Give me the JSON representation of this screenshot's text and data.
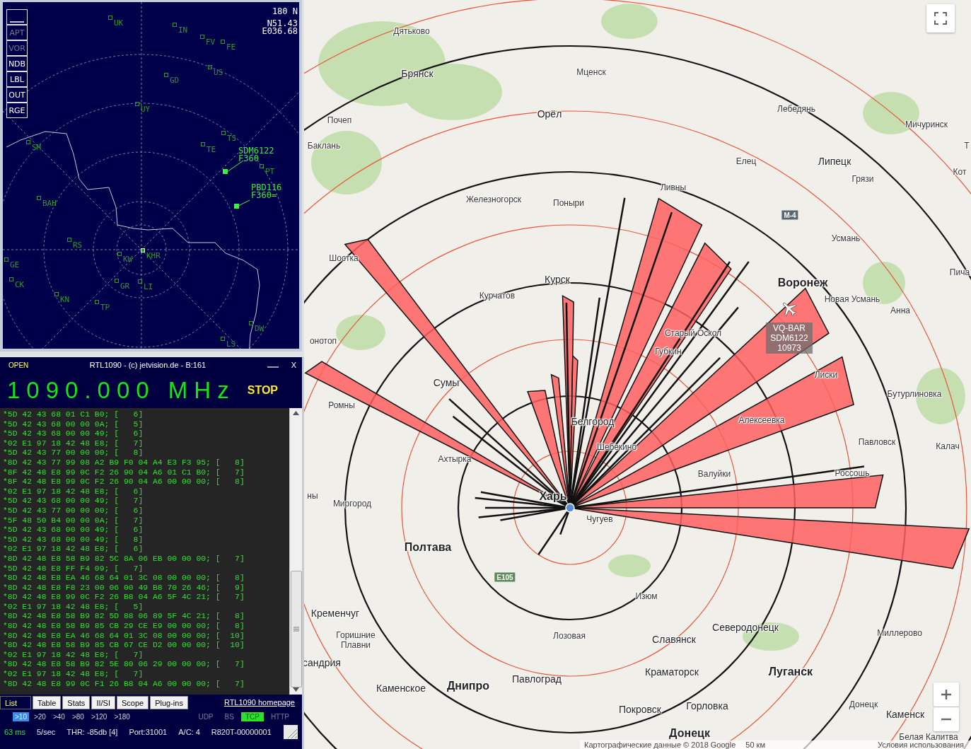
{
  "radar": {
    "buttons": [
      {
        "kind": "line",
        "on": true
      },
      {
        "kind": "text",
        "label": "APT",
        "on": false
      },
      {
        "kind": "text",
        "label": "VOR",
        "on": false
      },
      {
        "kind": "text",
        "label": "NDB",
        "on": true
      },
      {
        "kind": "text",
        "label": "LBL",
        "on": true
      },
      {
        "kind": "text",
        "label": "OUT",
        "on": true
      },
      {
        "kind": "text",
        "label": "RGE",
        "on": true
      }
    ],
    "range": "180 N",
    "position": [
      "N51.43",
      "E036.68"
    ],
    "fixes": [
      "UK",
      "IN",
      "FV",
      "FE",
      "US",
      "GD",
      "UY",
      "TS",
      "TE",
      "SM",
      "PT",
      "BAH",
      "RS",
      "GE",
      "KW",
      "KHR",
      "CK",
      "GR",
      "LI",
      "KN",
      "TP",
      "DW",
      "LS"
    ],
    "aircraft": [
      {
        "callsign": "SDM6122",
        "flight_level": "F360"
      },
      {
        "callsign": "PBD116",
        "flight_level": "F360="
      }
    ]
  },
  "receiver": {
    "open_label": "OPEN",
    "title": "RTL1090 - (c) jetvision.de - B:161",
    "close": "X",
    "frequency": "1090.000 MHz",
    "stop": "STOP",
    "messages": [
      "*5D 42 43 68 01 C1 B0; [   6]",
      "*5D 42 43 68 00 00 0A; [   5]",
      "*5D 42 43 68 00 00 49; [   6]",
      "*02 E1 97 18 42 48 E8; [   7]",
      "*5D 42 43 77 00 00 00; [   8]",
      "*8D 42 43 77 99 08 A2 B9 F0 04 A4 E3 F3 95; [   8]",
      "*8F 42 48 E8 99 0C F2 26 90 04 A6 01 C1 B0; [   7]",
      "*8F 42 48 E8 99 0C F2 26 90 04 A6 00 00 00; [   8]",
      "*02 E1 97 18 42 48 E8; [   6]",
      "*5D 42 43 68 00 00 49; [   7]",
      "*5D 42 43 77 00 00 00; [   6]",
      "*5F 48 50 B4 00 00 0A; [   7]",
      "*5D 42 43 68 00 00 49; [   6]",
      "*5D 42 43 68 00 00 49; [   8]",
      "*02 E1 97 18 42 48 E8; [   6]",
      "*8D 42 48 E8 58 B9 82 5C 8A 06 EB 00 00 00; [   7]",
      "*5D 42 48 E8 FF F4 09; [   7]",
      "*8D 42 48 E8 EA 46 68 64 01 3C 08 00 00 00; [   8]",
      "*8D 42 48 E8 F8 23 00 06 00 49 B8 70 26 46; [   9]",
      "*8D 42 48 E8 99 0C F2 26 B8 04 A6 5F 4C 21; [   7]",
      "*02 E1 97 18 42 48 E8; [   5]",
      "*8D 42 48 E8 58 B9 82 5D 88 06 89 5F 4C 21; [   8]",
      "*8D 42 48 E8 58 B9 85 CB 29 CE E9 00 00 00; [   8]",
      "*8D 42 48 E8 EA 46 68 64 01 3C 08 00 00 00; [  10]",
      "*8D 42 48 E8 58 B9 85 CB 67 CE D2 00 00 00; [  10]",
      "*02 E1 97 18 42 48 E8; [   7]",
      "*8D 42 48 E8 58 B9 82 5E 80 06 29 00 00 00; [   7]",
      "*02 E1 97 18 42 48 E8; [   7]",
      "*8D 42 48 E8 99 0C F1 26 B8 04 A6 00 00 00; [   7]"
    ],
    "tabs": [
      {
        "label": "List",
        "selected": true
      },
      {
        "label": "Table",
        "selected": false
      },
      {
        "label": "Stats",
        "selected": false
      },
      {
        "label": "II/SI",
        "selected": false
      },
      {
        "label": "Scope",
        "selected": false
      },
      {
        "label": "Plug-ins",
        "selected": false
      }
    ],
    "homepage_link": "RTL1090 homepage",
    "ranges": [
      {
        "label": ">10",
        "selected": true
      },
      {
        "label": ">20",
        "selected": false
      },
      {
        "label": ">40",
        "selected": false
      },
      {
        "label": ">80",
        "selected": false
      },
      {
        "label": ">120",
        "selected": false
      },
      {
        "label": ">180",
        "selected": false
      }
    ],
    "outputs": [
      {
        "label": "UDP",
        "on": false
      },
      {
        "label": "BS",
        "on": false
      },
      {
        "label": "TCP",
        "on": true
      },
      {
        "label": "HTTP",
        "on": false
      }
    ],
    "status": {
      "latency": "63 ms",
      "rate": "5/sec",
      "threshold": "THR: -85db [4]",
      "port": "Port:31001",
      "aircraft_count": "A/C: 4",
      "device": "R820T-00000001"
    }
  },
  "map": {
    "places": [
      {
        "name": "Дятьково",
        "kind": "town"
      },
      {
        "name": "Брянск",
        "kind": "city"
      },
      {
        "name": "Мценск",
        "kind": "town"
      },
      {
        "name": "Орёл",
        "kind": "city"
      },
      {
        "name": "Лебедянь",
        "kind": "town"
      },
      {
        "name": "Почеп",
        "kind": "town"
      },
      {
        "name": "Мичуринск",
        "kind": "town"
      },
      {
        "name": "Т",
        "kind": "town"
      },
      {
        "name": "Баклань",
        "kind": "town"
      },
      {
        "name": "Елец",
        "kind": "town"
      },
      {
        "name": "Липецк",
        "kind": "city"
      },
      {
        "name": "Кот",
        "kind": "town"
      },
      {
        "name": "Грязи",
        "kind": "town"
      },
      {
        "name": "Ливны",
        "kind": "town"
      },
      {
        "name": "Железногорск",
        "kind": "town"
      },
      {
        "name": "Поныри",
        "kind": "town"
      },
      {
        "name": "Усмань",
        "kind": "town"
      },
      {
        "name": "Шостка",
        "kind": "town"
      },
      {
        "name": "Пича",
        "kind": "town"
      },
      {
        "name": "Курск",
        "kind": "city"
      },
      {
        "name": "Воронеж",
        "kind": "major"
      },
      {
        "name": "Курчатов",
        "kind": "town"
      },
      {
        "name": "Новая Усмань",
        "kind": "town"
      },
      {
        "name": "Анна",
        "kind": "town"
      },
      {
        "name": "Старый Оскол",
        "kind": "town"
      },
      {
        "name": "онотоп",
        "kind": "town"
      },
      {
        "name": "Губкин",
        "kind": "town"
      },
      {
        "name": "Лиски",
        "kind": "town"
      },
      {
        "name": "Сумы",
        "kind": "city"
      },
      {
        "name": "Бутурлиновка",
        "kind": "town"
      },
      {
        "name": "Ромны",
        "kind": "town"
      },
      {
        "name": "Белгород",
        "kind": "city"
      },
      {
        "name": "Алексеевка",
        "kind": "town"
      },
      {
        "name": "Павловск",
        "kind": "town"
      },
      {
        "name": "Калач",
        "kind": "town"
      },
      {
        "name": "Шебекино",
        "kind": "town"
      },
      {
        "name": "Ахтырка",
        "kind": "town"
      },
      {
        "name": "Валуйки",
        "kind": "town"
      },
      {
        "name": "Россошь",
        "kind": "town"
      },
      {
        "name": "ны",
        "kind": "town"
      },
      {
        "name": "Харь",
        "kind": "major"
      },
      {
        "name": "Миргород",
        "kind": "town"
      },
      {
        "name": "Чугуев",
        "kind": "town"
      },
      {
        "name": "Полтава",
        "kind": "major"
      },
      {
        "name": "Изюм",
        "kind": "town"
      },
      {
        "name": "Кременчуг",
        "kind": "city"
      },
      {
        "name": "Горишние Плавни",
        "kind": "town"
      },
      {
        "name": "Лозовая",
        "kind": "town"
      },
      {
        "name": "Славянск",
        "kind": "city"
      },
      {
        "name": "Северодонецк",
        "kind": "city"
      },
      {
        "name": "Миллерово",
        "kind": "town"
      },
      {
        "name": "сандрия",
        "kind": "city"
      },
      {
        "name": "Краматорск",
        "kind": "city"
      },
      {
        "name": "Луганск",
        "kind": "major"
      },
      {
        "name": "Павлоград",
        "kind": "city"
      },
      {
        "name": "Днипро",
        "kind": "major"
      },
      {
        "name": "Каменское",
        "kind": "city"
      },
      {
        "name": "Донецк",
        "kind": "town"
      },
      {
        "name": "Покровск",
        "kind": "city"
      },
      {
        "name": "Горловка",
        "kind": "city"
      },
      {
        "name": "Каменск",
        "kind": "city"
      },
      {
        "name": "Белая Калитва",
        "kind": "town"
      },
      {
        "name": "Донецк",
        "kind": "major"
      }
    ],
    "road_shields": [
      {
        "label": "M-4",
        "color": "#5a6670"
      },
      {
        "label": "E105",
        "color": "#5b8a5b"
      }
    ],
    "aircraft_label": [
      "VQ-BAR",
      "SDM6122",
      "10973"
    ],
    "attribution": "Картографические данные © 2018 Google",
    "scale": "50 км",
    "terms": "Условия использования"
  }
}
